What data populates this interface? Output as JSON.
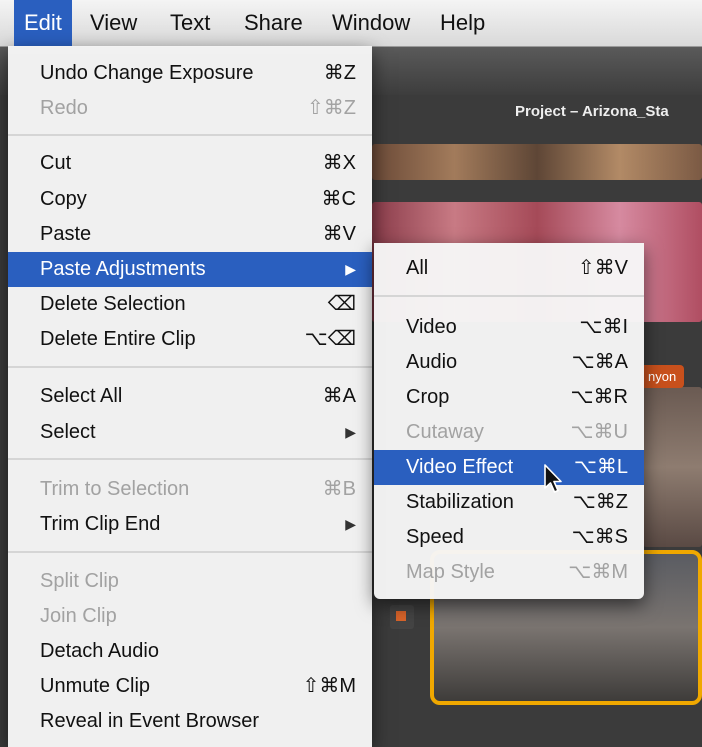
{
  "menubar": {
    "items": [
      "Edit",
      "View",
      "Text",
      "Share",
      "Window",
      "Help"
    ]
  },
  "project_title": "Project – Arizona_Sta",
  "tag_label": "nyon",
  "edit_menu": {
    "undo": {
      "label": "Undo Change Exposure",
      "shortcut": "⌘Z"
    },
    "redo": {
      "label": "Redo",
      "shortcut": "⇧⌘Z"
    },
    "cut": {
      "label": "Cut",
      "shortcut": "⌘X"
    },
    "copy": {
      "label": "Copy",
      "shortcut": "⌘C"
    },
    "paste": {
      "label": "Paste",
      "shortcut": "⌘V"
    },
    "paste_adjustments": {
      "label": "Paste Adjustments",
      "arrow": "▶"
    },
    "delete_selection": {
      "label": "Delete Selection",
      "shortcut": "⌫"
    },
    "delete_entire_clip": {
      "label": "Delete Entire Clip",
      "shortcut": "⌥⌫"
    },
    "select_all": {
      "label": "Select All",
      "shortcut": "⌘A"
    },
    "select": {
      "label": "Select",
      "arrow": "▶"
    },
    "trim_to_selection": {
      "label": "Trim to Selection",
      "shortcut": "⌘B"
    },
    "trim_clip_end": {
      "label": "Trim Clip End",
      "arrow": "▶"
    },
    "split_clip": {
      "label": "Split Clip"
    },
    "join_clip": {
      "label": "Join Clip"
    },
    "detach_audio": {
      "label": "Detach Audio"
    },
    "unmute_clip": {
      "label": "Unmute Clip",
      "shortcut": "⇧⌘M"
    },
    "reveal": {
      "label": "Reveal in Event Browser"
    }
  },
  "submenu": {
    "all": {
      "label": "All",
      "shortcut": "⇧⌘V"
    },
    "video": {
      "label": "Video",
      "shortcut": "⌥⌘I"
    },
    "audio": {
      "label": "Audio",
      "shortcut": "⌥⌘A"
    },
    "crop": {
      "label": "Crop",
      "shortcut": "⌥⌘R"
    },
    "cutaway": {
      "label": "Cutaway",
      "shortcut": "⌥⌘U"
    },
    "video_effect": {
      "label": "Video Effect",
      "shortcut": "⌥⌘L"
    },
    "stabilization": {
      "label": "Stabilization",
      "shortcut": "⌥⌘Z"
    },
    "speed": {
      "label": "Speed",
      "shortcut": "⌥⌘S"
    },
    "map_style": {
      "label": "Map Style",
      "shortcut": "⌥⌘M"
    }
  },
  "colors": {
    "highlight": "#2a5fbf",
    "accent_orange": "#c8501c",
    "timeline_yellow": "#f0a800"
  }
}
